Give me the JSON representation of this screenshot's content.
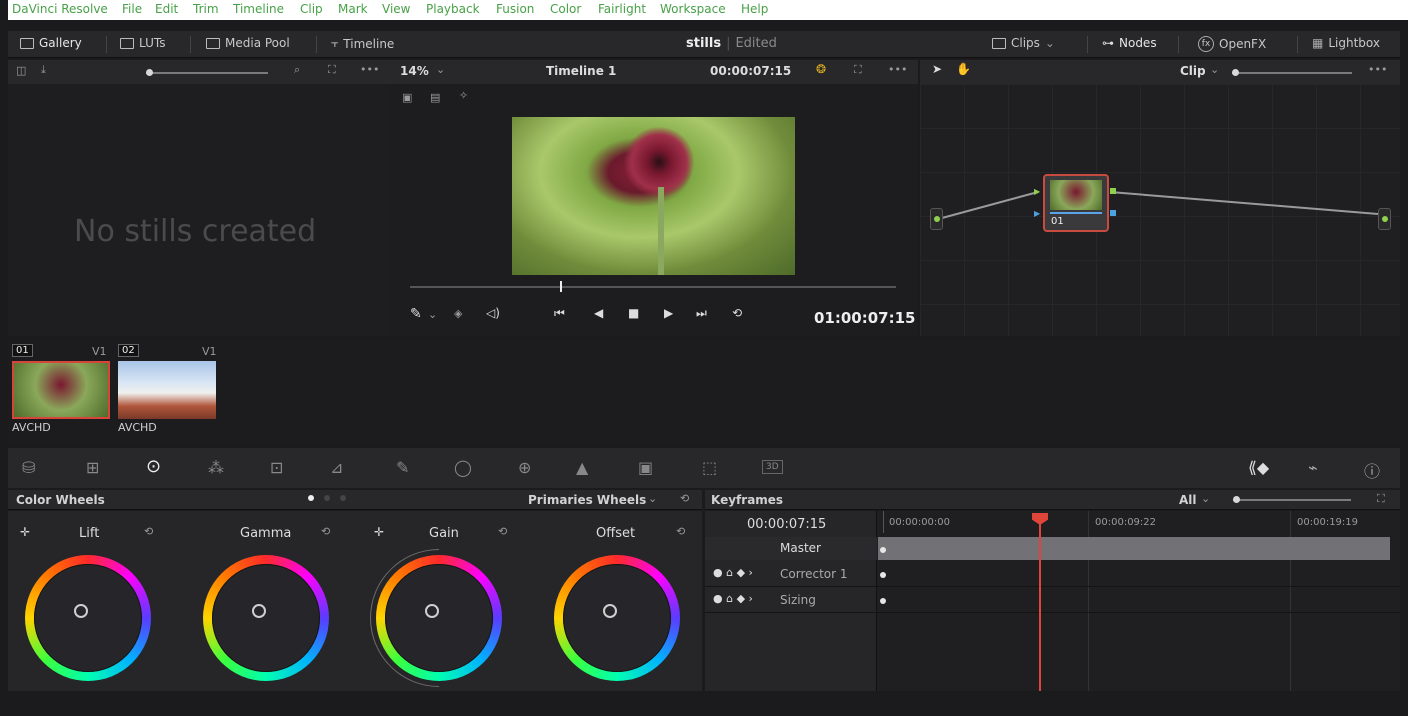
{
  "menubar": {
    "items": [
      "DaVinci Resolve",
      "File",
      "Edit",
      "Trim",
      "Timeline",
      "Clip",
      "Mark",
      "View",
      "Playback",
      "Fusion",
      "Color",
      "Fairlight",
      "Workspace",
      "Help"
    ]
  },
  "toolbar": {
    "gallery": "Gallery",
    "luts": "LUTs",
    "media_pool": "Media Pool",
    "timeline": "Timeline",
    "project_name": "stills",
    "project_status": "Edited",
    "clips": "Clips",
    "nodes": "Nodes",
    "openfx": "OpenFX",
    "lightbox": "Lightbox"
  },
  "gallery": {
    "empty_text": "No stills created"
  },
  "viewer": {
    "zoom": "14%",
    "timeline_name": "Timeline 1",
    "timecode_top": "00:00:07:15",
    "timecode": "01:00:07:15"
  },
  "nodes": {
    "mode": "Clip",
    "node_label": "01"
  },
  "clips": [
    {
      "number": "01",
      "track": "V1",
      "codec": "AVCHD"
    },
    {
      "number": "02",
      "track": "V1",
      "codec": "AVCHD"
    }
  ],
  "color_wheels": {
    "title": "Color Wheels",
    "mode": "Primaries Wheels",
    "wheels": [
      {
        "label": "Lift"
      },
      {
        "label": "Gamma"
      },
      {
        "label": "Gain"
      },
      {
        "label": "Offset"
      }
    ]
  },
  "keyframes": {
    "title": "Keyframes",
    "filter": "All",
    "current_time": "00:00:07:15",
    "ruler": [
      "00:00:00:00",
      "00:00:09:22",
      "00:00:19:19"
    ],
    "rows": [
      "Master",
      "Corrector 1",
      "Sizing"
    ]
  },
  "colors": {
    "accent_red": "#e0453a",
    "wheel_ring": "rainbow"
  }
}
